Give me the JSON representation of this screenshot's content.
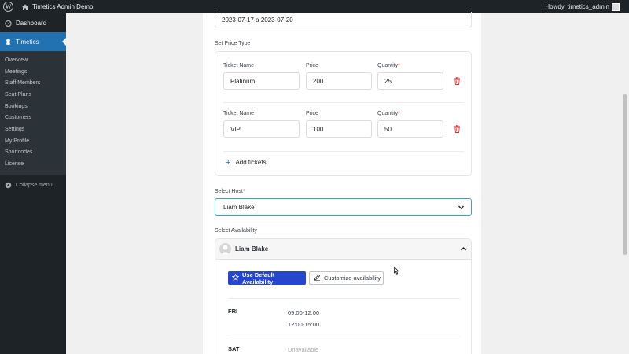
{
  "adminbar": {
    "site_name": "Timetics Admin Demo",
    "howdy": "Howdy, timetics_admin"
  },
  "sidebar": {
    "dashboard": "Dashboard",
    "plugin": "Timetics",
    "items": [
      "Overview",
      "Meetings",
      "Staff Members",
      "Seat Plans",
      "Bookings",
      "Customers",
      "Settings",
      "My Profile",
      "Shortcodes",
      "License"
    ],
    "collapse": "Collapse menu"
  },
  "form": {
    "date_range": "2023-07-17 a 2023-07-20",
    "price_type_label": "Set Price Type",
    "col_ticket_name": "Ticket Name",
    "col_price": "Price",
    "col_quantity": "Quantity",
    "required_mark": "*",
    "tickets": [
      {
        "name": "Platinum",
        "price": "200",
        "quantity": "25"
      },
      {
        "name": "VIP",
        "price": "100",
        "quantity": "50"
      }
    ],
    "add_tickets": "Add tickets",
    "host_label": "Select Host",
    "host_value": "Liam Blake",
    "availability_label": "Select Availability"
  },
  "availability": {
    "host_name": "Liam Blake",
    "default_btn": "Use Default Availability",
    "customize_btn": "Customize availability",
    "days": [
      {
        "day": "FRI",
        "slots": [
          "09:00-12:00",
          "12:00-15:00"
        ]
      },
      {
        "day": "SAT",
        "unavailable": "Unavailable"
      }
    ]
  },
  "colors": {
    "primary": "#2547d0",
    "wp_blue": "#2271b1",
    "sidebar": "#1d2327",
    "danger": "#d63638",
    "focus": "#3aa7b5"
  },
  "icons": [
    "wordpress-logo-icon",
    "home-icon",
    "dashboard-icon",
    "timetics-icon",
    "collapse-icon",
    "trash-icon",
    "plus-icon",
    "chevron-down-icon",
    "chevron-up-icon",
    "star-icon",
    "pencil-icon",
    "avatar-icon"
  ]
}
